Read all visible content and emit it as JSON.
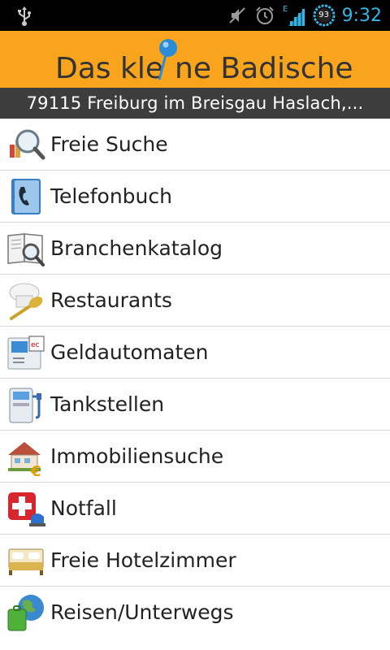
{
  "status_bar": {
    "time": "9:32",
    "battery_level": "93",
    "network_type": "E",
    "icons": [
      "usb-icon",
      "mute-icon",
      "alarm-icon",
      "signal-icon",
      "battery-icon"
    ]
  },
  "header": {
    "logo_text_left": "Das kle",
    "logo_text_right": "ne Badische",
    "background_color": "#f9a41d"
  },
  "location": {
    "text": "79115 Freiburg im Breisgau Haslach,..."
  },
  "menu": [
    {
      "label": "Freie Suche",
      "icon": "magnifier-chart-icon"
    },
    {
      "label": "Telefonbuch",
      "icon": "phonebook-icon"
    },
    {
      "label": "Branchenkatalog",
      "icon": "catalog-magnifier-icon"
    },
    {
      "label": "Restaurants",
      "icon": "chef-hat-spoon-icon"
    },
    {
      "label": "Geldautomaten",
      "icon": "atm-icon"
    },
    {
      "label": "Tankstellen",
      "icon": "fuel-pump-icon"
    },
    {
      "label": "Immobiliensuche",
      "icon": "house-euro-icon"
    },
    {
      "label": "Notfall",
      "icon": "emergency-cross-icon"
    },
    {
      "label": "Freie Hotelzimmer",
      "icon": "hotel-bed-icon"
    },
    {
      "label": "Reisen/Unterwegs",
      "icon": "globe-luggage-icon"
    }
  ]
}
